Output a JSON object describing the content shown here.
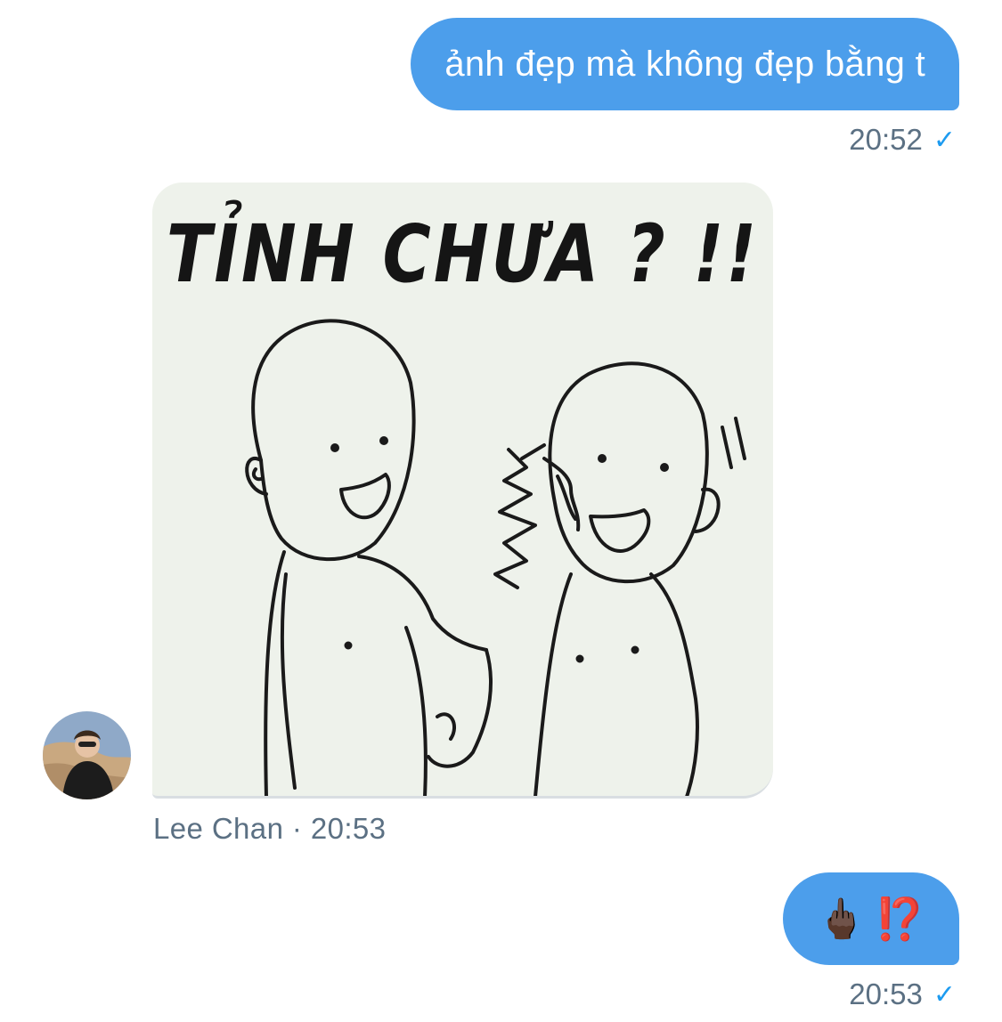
{
  "messages": [
    {
      "direction": "outgoing",
      "text": "ảnh đẹp mà không đẹp bằng t",
      "time": "20:52",
      "status_icon": "check-icon"
    },
    {
      "direction": "incoming",
      "type": "image",
      "image_text": "TỈNH CHƯA ? !!",
      "sender": "Lee Chan",
      "separator": "·",
      "time": "20:53",
      "meta": "Lee Chan · 20:53"
    },
    {
      "direction": "outgoing",
      "emoji_hand": "🖕🏿",
      "emoji_mark": "⁉️",
      "time": "20:53",
      "status_icon": "check-icon"
    }
  ],
  "check_glyph": "✓",
  "colors": {
    "outgoing_bubble": "#4c9eeb",
    "meta_text": "#5b7083",
    "check": "#1d9bf0"
  }
}
